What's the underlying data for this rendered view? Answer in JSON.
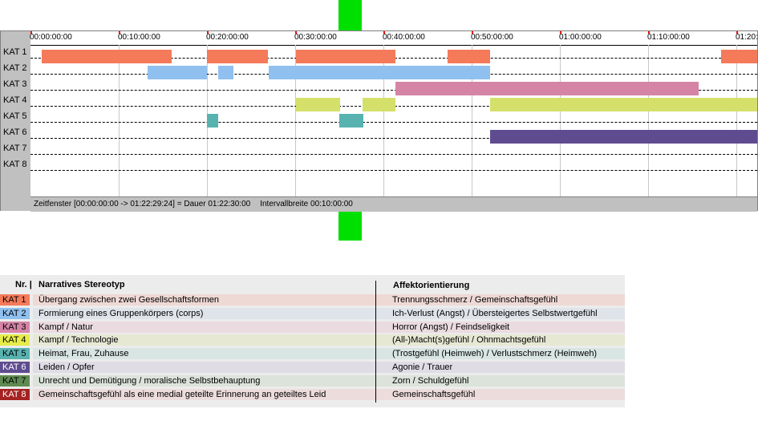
{
  "timeline": {
    "ruler_labels": [
      "00:00:00:00",
      "00:10:00:00",
      "00:20:00:00",
      "00:30:00:00",
      "00:40:00:00",
      "00:50:00:00",
      "01:00:00:00",
      "01:10:00:00",
      "01:20:"
    ],
    "row_labels": [
      "KAT 1",
      "KAT 2",
      "KAT 3",
      "KAT 4",
      "KAT 5",
      "KAT 6",
      "KAT 7",
      "KAT 8"
    ],
    "status_window": "Zeitfenster [00:00:00:00 -> 01:22:29:24] = Dauer 01:22:30:00",
    "status_interval": "Intervallbreite 00:10:00:00",
    "total_minutes": 82.5,
    "segments": [
      {
        "row": 0,
        "start": 1.3,
        "end": 16.0,
        "color": "#f47a5a"
      },
      {
        "row": 0,
        "start": 20.0,
        "end": 26.9,
        "color": "#f47a5a"
      },
      {
        "row": 0,
        "start": 30.1,
        "end": 41.4,
        "color": "#f47a5a"
      },
      {
        "row": 0,
        "start": 47.3,
        "end": 52.1,
        "color": "#f47a5a"
      },
      {
        "row": 0,
        "start": 78.3,
        "end": 82.5,
        "color": "#f47a5a"
      },
      {
        "row": 1,
        "start": 13.3,
        "end": 20.0,
        "color": "#90c0ef"
      },
      {
        "row": 1,
        "start": 21.3,
        "end": 23.0,
        "color": "#90c0ef"
      },
      {
        "row": 1,
        "start": 27.0,
        "end": 52.1,
        "color": "#90c0ef"
      },
      {
        "row": 2,
        "start": 41.4,
        "end": 75.7,
        "color": "#d584a6"
      },
      {
        "row": 3,
        "start": 30.1,
        "end": 35.1,
        "color": "#d4e06a"
      },
      {
        "row": 3,
        "start": 37.6,
        "end": 41.4,
        "color": "#d4e06a"
      },
      {
        "row": 3,
        "start": 52.1,
        "end": 82.5,
        "color": "#d4e06a"
      },
      {
        "row": 4,
        "start": 20.0,
        "end": 21.3,
        "color": "#58b2b0"
      },
      {
        "row": 4,
        "start": 35.0,
        "end": 37.7,
        "color": "#58b2b0"
      },
      {
        "row": 5,
        "start": 52.1,
        "end": 82.5,
        "color": "#5f4c90"
      }
    ]
  },
  "legend": {
    "headers": {
      "nr": "Nr. |",
      "stereotyp": "Narratives Stereotyp",
      "affekt": "Affektorientierung"
    },
    "rows": [
      {
        "cat": "KAT 1",
        "cat_color": "#f47a5a",
        "text_color": "#000000",
        "row_bg": "#efd9d5",
        "stereotyp": "Übergang zwischen zwei Gesellschaftsformen",
        "affekt": "Trennungsschmerz / Gemeinschaftsgefühl"
      },
      {
        "cat": "KAT 2",
        "cat_color": "#90c0ef",
        "text_color": "#000000",
        "row_bg": "#dfe3ea",
        "stereotyp": "Formierung eines Gruppenkörpers (corps)",
        "affekt": "Ich-Verlust (Angst) / Übersteigertes Selbstwertgefühl"
      },
      {
        "cat": "KAT 3",
        "cat_color": "#d584a6",
        "text_color": "#000000",
        "row_bg": "#eadbe0",
        "stereotyp": "Kampf / Natur",
        "affekt": "Horror (Angst) / Feindseligkeit"
      },
      {
        "cat": "KAT 4",
        "cat_color": "#e6ec4a",
        "text_color": "#000000",
        "row_bg": "#e6e8d3",
        "stereotyp": "Kampf / Technologie",
        "affekt": "(All-)Macht(s)gefühl / Ohnmachtsgefühl"
      },
      {
        "cat": "KAT 5",
        "cat_color": "#58b2b0",
        "text_color": "#000000",
        "row_bg": "#d8e5e3",
        "stereotyp": "Heimat, Frau, Zuhause",
        "affekt": "(Trostgefühl (Heimweh) / Verlustschmerz (Heimweh)"
      },
      {
        "cat": "KAT 6",
        "cat_color": "#5f4c90",
        "text_color": "#ffffff",
        "row_bg": "#dfdce6",
        "stereotyp": "Leiden / Opfer",
        "affekt": "Agonie / Trauer"
      },
      {
        "cat": "KAT 7",
        "cat_color": "#5f8a52",
        "text_color": "#000000",
        "row_bg": "#dce3db",
        "stereotyp": "Unrecht und Demütigung / moralische Selbstbehauptung",
        "affekt": "Zorn / Schuldgefühl"
      },
      {
        "cat": "KAT 8",
        "cat_color": "#a52222",
        "text_color": "#ffffff",
        "row_bg": "#ecdcdc",
        "stereotyp": "Gemeinschaftsgefühl als eine medial geteilte Erinnerung an geteiltes Leid",
        "affekt": "Gemeinschaftsgefühl"
      }
    ]
  }
}
